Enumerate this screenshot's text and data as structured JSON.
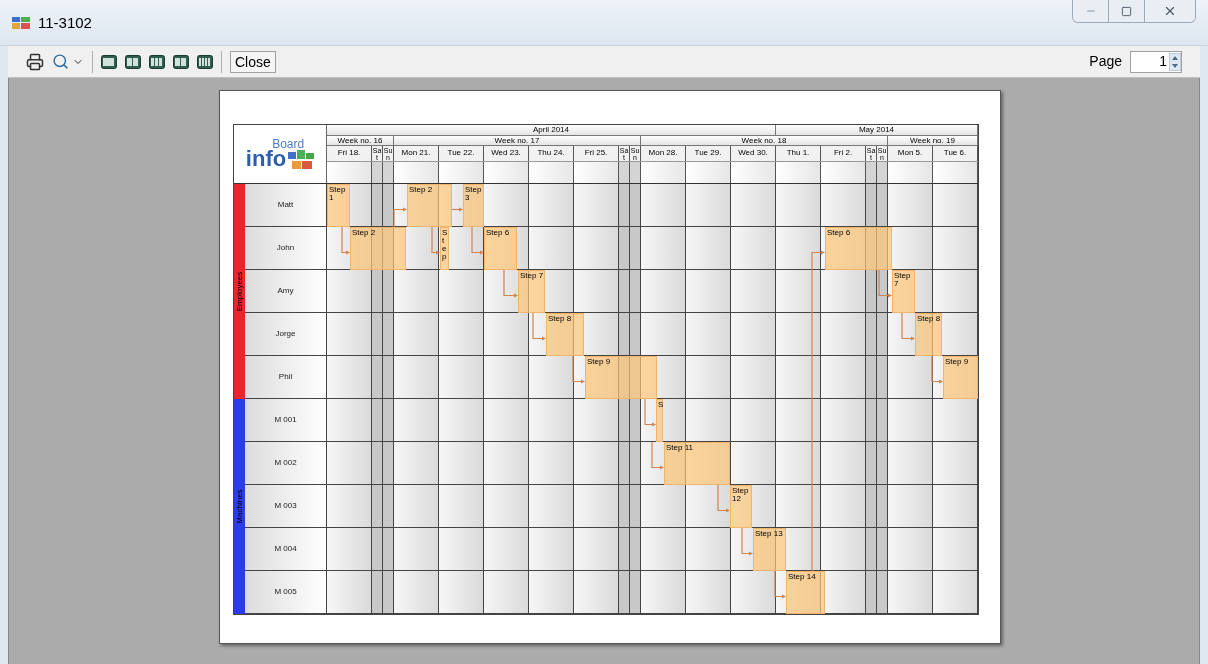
{
  "window": {
    "title": "11-3102"
  },
  "toolbar": {
    "close_button": "Close",
    "page_label": "Page",
    "page_value": "1"
  },
  "chart": {
    "logo": {
      "part_1": "info",
      "part_2": "Board"
    },
    "months": [
      {
        "label": "April 2014"
      },
      {
        "label": "May 2014"
      }
    ],
    "weeks": [
      {
        "label": "Week no. 16"
      },
      {
        "label": "Week no. 17"
      },
      {
        "label": "Week no. 18"
      },
      {
        "label": "Week no. 19"
      }
    ],
    "days": [
      {
        "label": "Fri 18.",
        "kind": "weekday"
      },
      {
        "label": "Sat",
        "kind": "weekend"
      },
      {
        "label": "Sun",
        "kind": "weekend"
      },
      {
        "label": "Mon 21.",
        "kind": "weekday"
      },
      {
        "label": "Tue 22.",
        "kind": "weekday"
      },
      {
        "label": "Wed 23.",
        "kind": "weekday"
      },
      {
        "label": "Thu 24.",
        "kind": "weekday"
      },
      {
        "label": "Fri 25.",
        "kind": "weekday"
      },
      {
        "label": "Sat",
        "kind": "weekend"
      },
      {
        "label": "Sun",
        "kind": "weekend"
      },
      {
        "label": "Mon 28.",
        "kind": "weekday"
      },
      {
        "label": "Tue 29.",
        "kind": "weekday"
      },
      {
        "label": "Wed 30.",
        "kind": "weekday"
      },
      {
        "label": "Thu 1.",
        "kind": "weekday"
      },
      {
        "label": "Fri 2.",
        "kind": "weekday"
      },
      {
        "label": "Sat",
        "kind": "weekend"
      },
      {
        "label": "Sun",
        "kind": "weekend"
      },
      {
        "label": "Mon 5.",
        "kind": "weekday"
      },
      {
        "label": "Tue 6.",
        "kind": "weekday"
      }
    ],
    "groups": [
      {
        "label": "Employees",
        "color": "#e8262b",
        "rows": [
          {
            "name": "Matt",
            "tasks": [
              {
                "label": "Step 1"
              },
              {
                "label": "Step 2"
              },
              {
                "label": "Step 3"
              }
            ]
          },
          {
            "name": "John",
            "tasks": [
              {
                "label": "Step 2"
              },
              {
                "label": "Step"
              },
              {
                "label": "Step 6"
              },
              {
                "label": "Step 6"
              }
            ]
          },
          {
            "name": "Amy",
            "tasks": [
              {
                "label": "Step 7"
              },
              {
                "label": "Step 7"
              }
            ]
          },
          {
            "name": "Jorge",
            "tasks": [
              {
                "label": "Step 8"
              },
              {
                "label": "Step 8"
              }
            ]
          },
          {
            "name": "Phil",
            "tasks": [
              {
                "label": "Step 9"
              },
              {
                "label": "Step 9"
              }
            ]
          }
        ]
      },
      {
        "label": "Machines",
        "color": "#2b3ee6",
        "rows": [
          {
            "name": "M 001",
            "tasks": [
              {
                "label": "S"
              }
            ]
          },
          {
            "name": "M 002",
            "tasks": [
              {
                "label": "Step 11"
              }
            ]
          },
          {
            "name": "M 003",
            "tasks": [
              {
                "label": "Step 12"
              }
            ]
          },
          {
            "name": "M 004",
            "tasks": [
              {
                "label": "Step 13"
              }
            ]
          },
          {
            "name": "M 005",
            "tasks": [
              {
                "label": "Step 14"
              }
            ]
          }
        ]
      }
    ]
  }
}
